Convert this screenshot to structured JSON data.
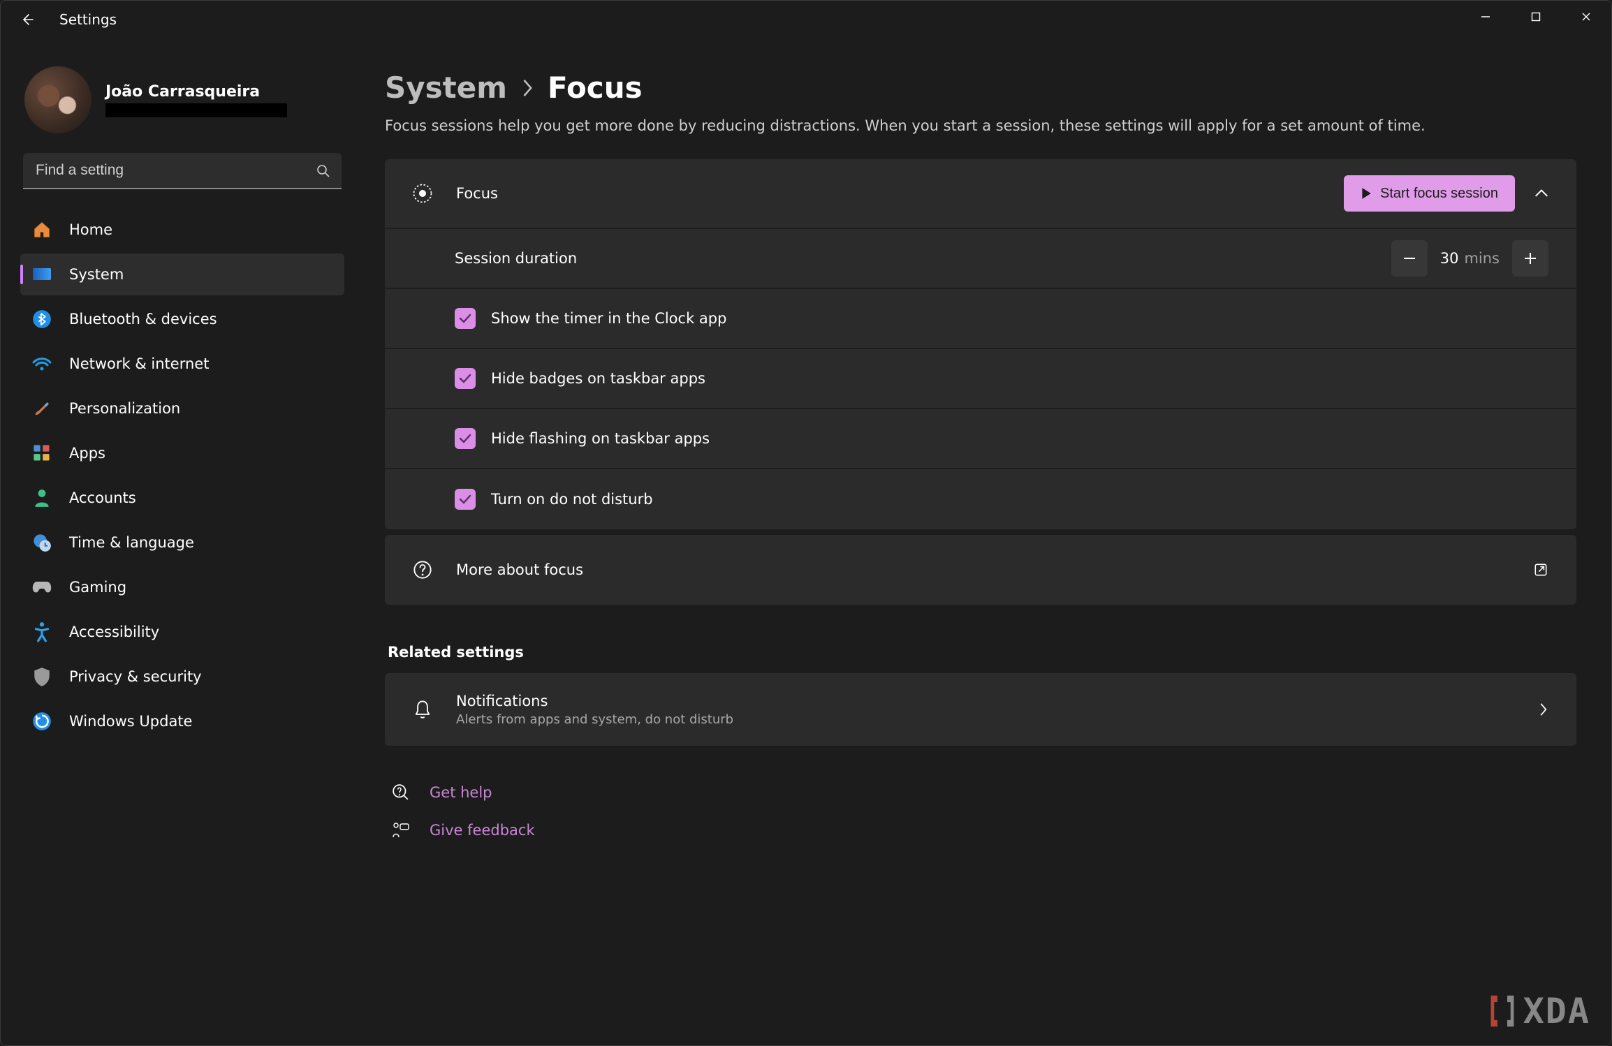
{
  "app_title": "Settings",
  "user": {
    "name": "João Carrasqueira"
  },
  "search": {
    "placeholder": "Find a setting"
  },
  "sidebar": {
    "items": [
      {
        "label": "Home"
      },
      {
        "label": "System"
      },
      {
        "label": "Bluetooth & devices"
      },
      {
        "label": "Network & internet"
      },
      {
        "label": "Personalization"
      },
      {
        "label": "Apps"
      },
      {
        "label": "Accounts"
      },
      {
        "label": "Time & language"
      },
      {
        "label": "Gaming"
      },
      {
        "label": "Accessibility"
      },
      {
        "label": "Privacy & security"
      },
      {
        "label": "Windows Update"
      }
    ]
  },
  "breadcrumb": {
    "parent": "System",
    "current": "Focus"
  },
  "description": "Focus sessions help you get more done by reducing distractions. When you start a session, these settings will apply for a set amount of time.",
  "focus": {
    "header_label": "Focus",
    "start_button": "Start focus session",
    "session_duration_label": "Session duration",
    "session_duration_value": "30",
    "session_duration_unit": "mins",
    "options": [
      {
        "label": "Show the timer in the Clock app",
        "checked": true
      },
      {
        "label": "Hide badges on taskbar apps",
        "checked": true
      },
      {
        "label": "Hide flashing on taskbar apps",
        "checked": true
      },
      {
        "label": "Turn on do not disturb",
        "checked": true
      }
    ],
    "more_label": "More about focus"
  },
  "related": {
    "title": "Related settings",
    "notifications": {
      "title": "Notifications",
      "subtitle": "Alerts from apps and system, do not disturb"
    }
  },
  "links": {
    "help": "Get help",
    "feedback": "Give feedback"
  },
  "colors": {
    "accent": "#e09ce9",
    "link": "#c887d3",
    "bg": "#1c1c1c",
    "panel": "#2b2b2b"
  },
  "watermark": "XDA"
}
